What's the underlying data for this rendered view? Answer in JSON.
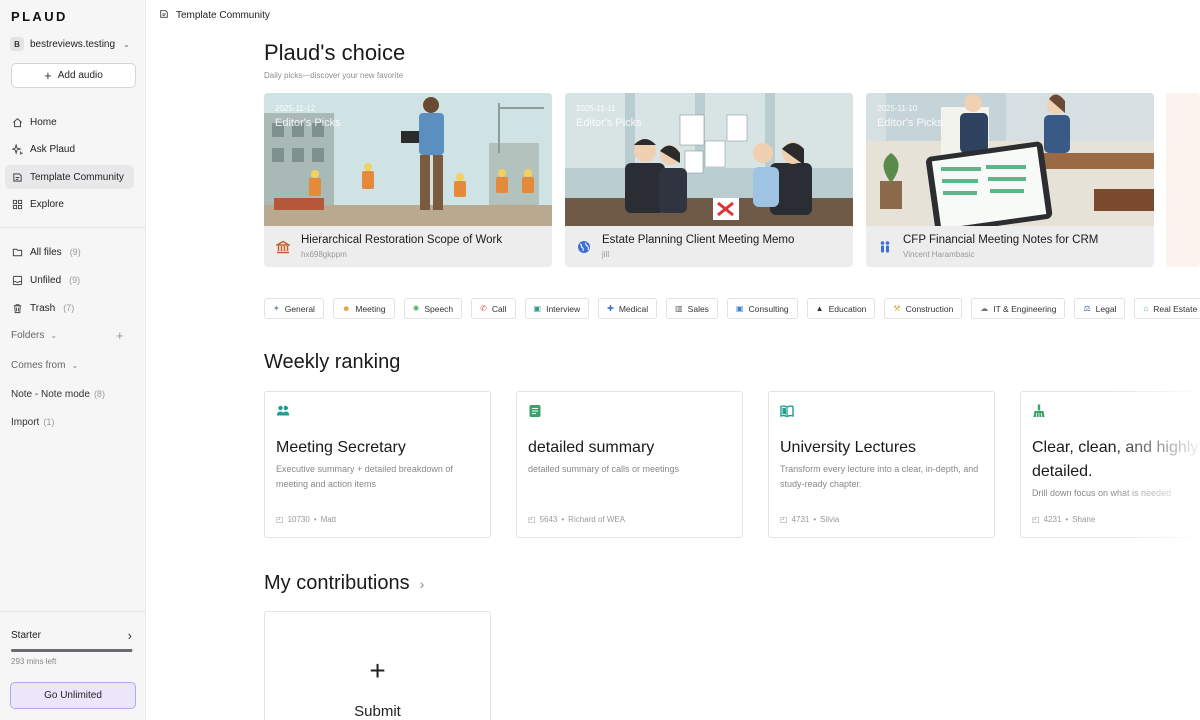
{
  "app": {
    "logo": "PLAUD"
  },
  "sidebar": {
    "account_initial": "B",
    "account_name": "bestreviews.testing",
    "add_audio": "Add audio",
    "nav": [
      {
        "label": "Home"
      },
      {
        "label": "Ask Plaud"
      },
      {
        "label": "Template Community"
      },
      {
        "label": "Explore"
      }
    ],
    "files": [
      {
        "label": "All files",
        "count": "(9)"
      },
      {
        "label": "Unfiled",
        "count": "(9)"
      },
      {
        "label": "Trash",
        "count": "(7)"
      }
    ],
    "folders_label": "Folders",
    "comes_from_label": "Comes from",
    "sources": [
      {
        "label": "Note - Note mode",
        "count": "(8)"
      },
      {
        "label": "Import",
        "count": "(1)"
      }
    ],
    "plan_name": "Starter",
    "usage_fraction": 0.99,
    "mins_left": "293 mins left",
    "go_unlimited": "Go Unlimited"
  },
  "header": {
    "breadcrumb": "Template Community"
  },
  "main": {
    "choice_title": "Plaud's choice",
    "choice_subtitle": "Daily picks—discover your new favorite",
    "picks": [
      {
        "date": "2025-11-12",
        "tag": "Editor's Picks",
        "title": "Hierarchical Restoration Scope of Work",
        "author": "hx698gkppm"
      },
      {
        "date": "2025-11-11",
        "tag": "Editor's Picks",
        "title": "Estate Planning Client Meeting Memo",
        "author": "jill"
      },
      {
        "date": "2025-11-10",
        "tag": "Editor's Picks",
        "title": "CFP Financial Meeting Notes for CRM",
        "author": "Vincent Harambasic"
      }
    ],
    "categories": [
      {
        "label": "General",
        "icon": "sparkle-icon",
        "color": "#7a8fa6"
      },
      {
        "label": "Meeting",
        "icon": "people-icon",
        "color": "#e89a3c"
      },
      {
        "label": "Speech",
        "icon": "lightbulb-icon",
        "color": "#58b368"
      },
      {
        "label": "Call",
        "icon": "phone-icon",
        "color": "#e0553f"
      },
      {
        "label": "Interview",
        "icon": "chat-icon",
        "color": "#2f9e8f"
      },
      {
        "label": "Medical",
        "icon": "medical-icon",
        "color": "#3d6fd8"
      },
      {
        "label": "Sales",
        "icon": "chart-icon",
        "color": "#5a5a5a"
      },
      {
        "label": "Consulting",
        "icon": "chat-icon",
        "color": "#3b82d6"
      },
      {
        "label": "Education",
        "icon": "graduation-icon",
        "color": "#333333"
      },
      {
        "label": "Construction",
        "icon": "hammer-icon",
        "color": "#e5a23a"
      },
      {
        "label": "IT & Engineering",
        "icon": "cloud-icon",
        "color": "#777777"
      },
      {
        "label": "Legal",
        "icon": "scale-icon",
        "color": "#3f5d8a"
      },
      {
        "label": "Real Estate",
        "icon": "house-icon",
        "color": "#5b9bd5"
      }
    ],
    "weekly_title": "Weekly ranking",
    "rankings": [
      {
        "title": "Meeting Secretary",
        "desc": "Executive summary + detailed breakdown of meeting and action items",
        "uses": "10730",
        "author": "Matt",
        "icon": "people-icon",
        "color": "#1f9e8f"
      },
      {
        "title": "detailed summary",
        "desc": "detailed summary of calls or meetings",
        "uses": "5643",
        "author": "Richard of WEA",
        "icon": "document-icon",
        "color": "#3aa36b"
      },
      {
        "title": "University Lectures",
        "desc": "Transform every lecture into a clear, in-depth, and study-ready chapter.",
        "uses": "4731",
        "author": "Silvia",
        "icon": "book-icon",
        "color": "#1f9e8f"
      },
      {
        "title": "Clear, clean, and highly detailed.",
        "desc": "Drill down focus on what is needed",
        "uses": "4231",
        "author": "Shane",
        "icon": "broom-icon",
        "color": "#3aa36b"
      }
    ],
    "contrib_title": "My contributions",
    "submit_label": "Submit"
  }
}
